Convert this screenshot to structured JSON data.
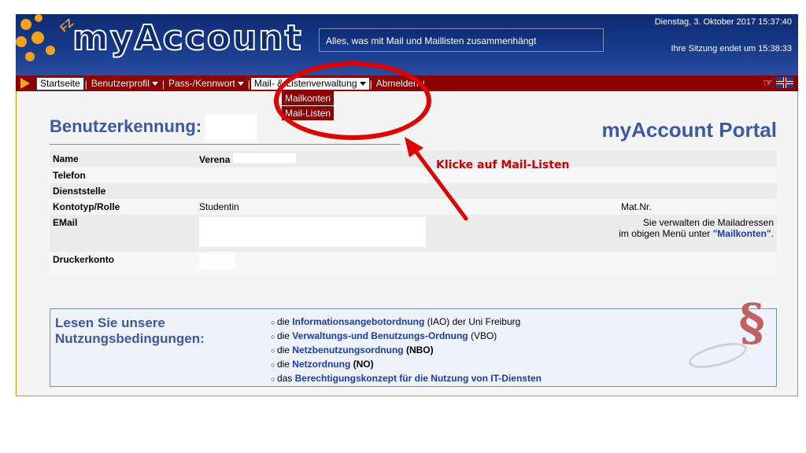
{
  "header": {
    "logo": "myAccount",
    "tagline": "Alles, was mit Mail und Maillisten zusammenhängt",
    "date": "Dienstag, 3. Oktober 2017 15:37:40",
    "session": "Ihre Sitzung endet um 15:38:33"
  },
  "nav": {
    "items": [
      {
        "label": "Startseite"
      },
      {
        "label": "Benutzerprofil"
      },
      {
        "label": "Pass-/Kennwort"
      },
      {
        "label": "Mail- & Listenverwaltung"
      },
      {
        "label": "Abmelden"
      }
    ],
    "dropdown": [
      "Mailkonten",
      "Mail-Listen"
    ]
  },
  "main": {
    "benutzer_title": "Benutzerkennung:",
    "portal_title": "myAccount Portal",
    "rows": {
      "name": {
        "label": "Name",
        "value": "Verena"
      },
      "telefon": {
        "label": "Telefon"
      },
      "dienststelle": {
        "label": "Dienststelle"
      },
      "kontotyp": {
        "label": "Kontotyp/Rolle",
        "value": "Studentin",
        "right": "Mat.Nr."
      },
      "email": {
        "label": "EMail",
        "right_line1": "Sie verwalten die Mailadressen",
        "right_line2_pre": "im obigen Menü unter ",
        "right_link": "\"Mailkonten\"",
        "right_line2_post": "."
      },
      "drucker": {
        "label": "Druckerkonto"
      }
    },
    "annotation": "Klicke auf Mail-Listen"
  },
  "nutzung": {
    "title_line1": "Lesen Sie unsere",
    "title_line2": "Nutzungsbedingungen:",
    "items": [
      {
        "pre": "die ",
        "link": "Informationsangebotordnung",
        "post": " (IAO) der Uni Freiburg"
      },
      {
        "pre": "die ",
        "link": "Verwaltungs-und Benutzungs-Ordnung",
        "post": " (VBO)"
      },
      {
        "pre": "die ",
        "link": "Netzbenutzungsordnung",
        "post": " (NBO)"
      },
      {
        "pre": "die ",
        "link": "Netzordnung",
        "post": " (NO)"
      },
      {
        "pre": "das ",
        "link": "Berechtigungskonzept für die Nutzung von IT-Diensten",
        "post": ""
      }
    ],
    "icon_glyph": "§"
  },
  "colors": {
    "header_bg": "#0d2b72",
    "nav_bg": "#8b0000",
    "title_blue": "#3a5aa5",
    "annotation_red": "#d00000",
    "logo_orange": "#f4a21b"
  }
}
